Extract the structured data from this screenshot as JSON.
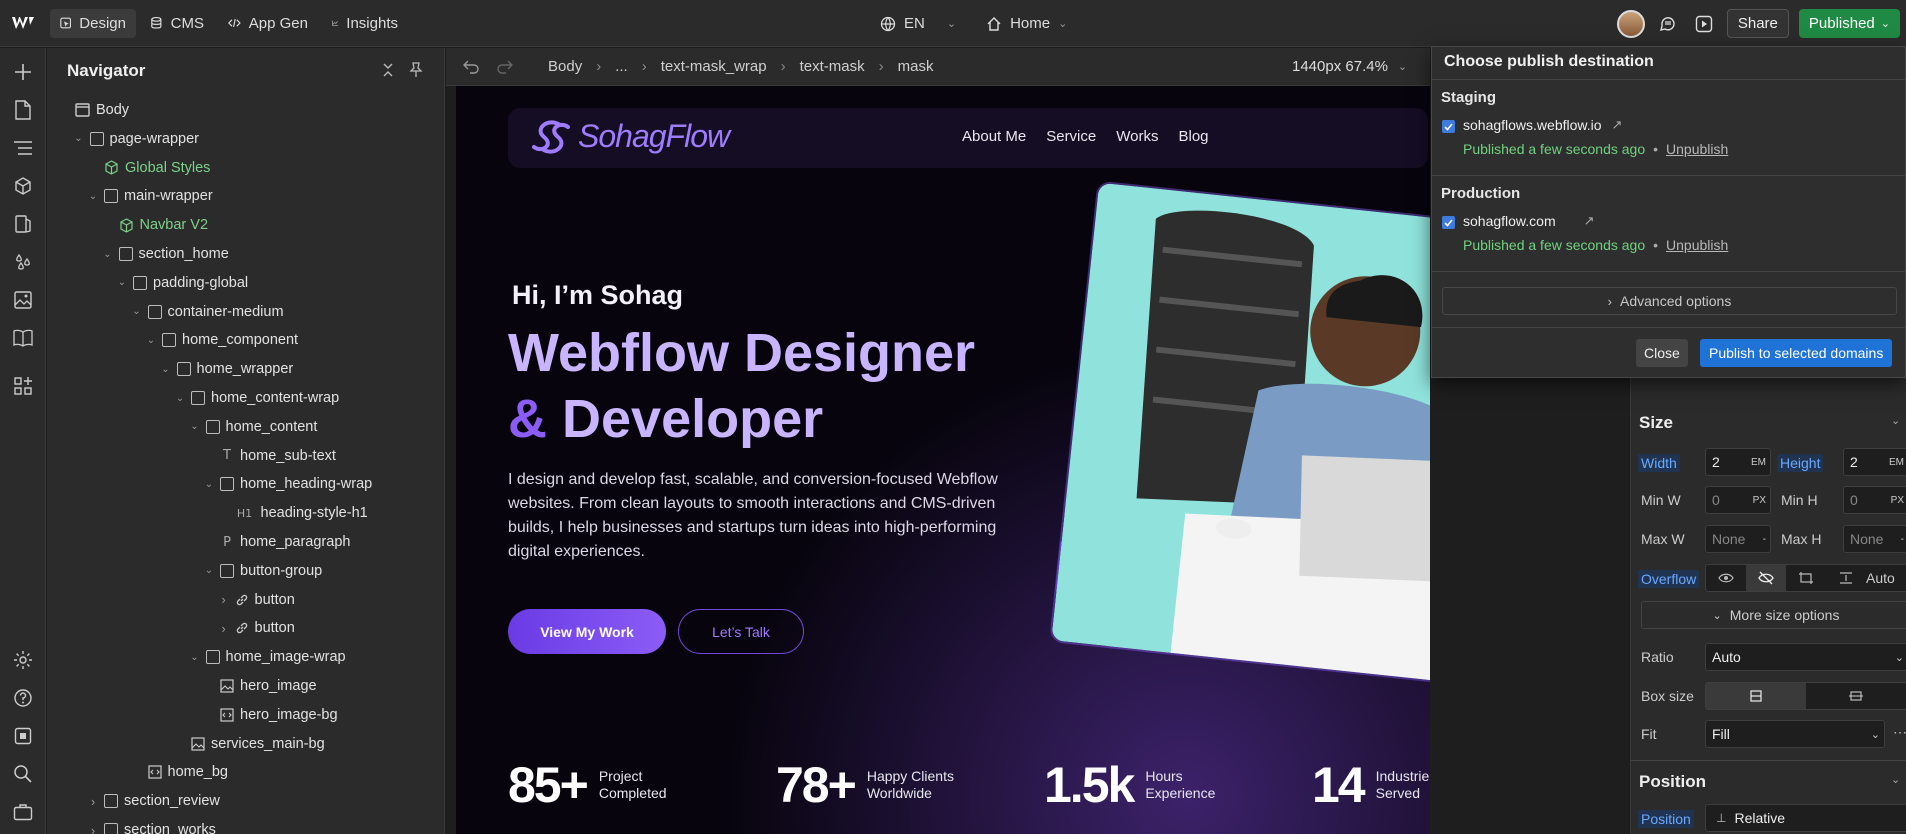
{
  "topbar": {
    "modes": [
      {
        "label": "Design",
        "icon": "cursor-icon"
      },
      {
        "label": "CMS",
        "icon": "database-icon"
      },
      {
        "label": "App Gen",
        "icon": "code-icon"
      },
      {
        "label": "Insights",
        "icon": "chart-icon"
      }
    ],
    "locale": "EN",
    "page": "Home",
    "share_label": "Share",
    "publish_label": "Published"
  },
  "navigator": {
    "title": "Navigator",
    "nodes": [
      {
        "label": "Body",
        "kind": "body"
      },
      {
        "label": "page-wrapper",
        "kind": "box"
      },
      {
        "label": "Global Styles",
        "kind": "component"
      },
      {
        "label": "main-wrapper",
        "kind": "box"
      },
      {
        "label": "Navbar V2",
        "kind": "component"
      },
      {
        "label": "section_home",
        "kind": "box"
      },
      {
        "label": "padding-global",
        "kind": "box"
      },
      {
        "label": "container-medium",
        "kind": "box"
      },
      {
        "label": "home_component",
        "kind": "box"
      },
      {
        "label": "home_wrapper",
        "kind": "box"
      },
      {
        "label": "home_content-wrap",
        "kind": "box"
      },
      {
        "label": "home_content",
        "kind": "box"
      },
      {
        "label": "home_sub-text",
        "kind": "text",
        "tag": "T"
      },
      {
        "label": "home_heading-wrap",
        "kind": "box"
      },
      {
        "label": "heading-style-h1",
        "kind": "heading",
        "tag": "H1"
      },
      {
        "label": "home_paragraph",
        "kind": "paragraph",
        "tag": "P"
      },
      {
        "label": "button-group",
        "kind": "box"
      },
      {
        "label": "button",
        "kind": "link"
      },
      {
        "label": "button",
        "kind": "link"
      },
      {
        "label": "home_image-wrap",
        "kind": "box"
      },
      {
        "label": "hero_image",
        "kind": "image"
      },
      {
        "label": "hero_image-bg",
        "kind": "embed"
      },
      {
        "label": "services_main-bg",
        "kind": "image"
      },
      {
        "label": "home_bg",
        "kind": "embed"
      },
      {
        "label": "section_review",
        "kind": "box"
      },
      {
        "label": "section_works",
        "kind": "box"
      }
    ]
  },
  "canvas_bar": {
    "breadcrumb": [
      "Body",
      "...",
      "text-mask_wrap",
      "text-mask",
      "mask"
    ],
    "zoom": "1440px 67.4%"
  },
  "site": {
    "brand": "SohagFlow",
    "links": [
      "About Me",
      "Service",
      "Works",
      "Blog"
    ],
    "hi": "Hi, I’m Sohag",
    "heading_line1": "Webflow Designer",
    "heading_amp": "&",
    "heading_line2": " Developer",
    "paragraph": "I design and develop fast, scalable, and conversion-focused Webflow websites. From clean layouts to smooth interactions and CMS-driven builds, I help businesses and startups turn ideas into high-performing digital experiences.",
    "btn_primary": "View My Work",
    "btn_secondary": "Let’s Talk",
    "stats": [
      {
        "num": "85+",
        "l1": "Project",
        "l2": "Completed"
      },
      {
        "num": "78+",
        "l1": "Happy Clients",
        "l2": "Worldwide"
      },
      {
        "num": "1.5k",
        "l1": "Hours",
        "l2": "Experience"
      },
      {
        "num": "14",
        "l1": "Industries",
        "l2": "Served"
      }
    ]
  },
  "publish_popup": {
    "title": "Choose publish destination",
    "staging_label": "Staging",
    "staging_domain": "sohagflows.webflow.io",
    "staging_status": "Published a few seconds ago",
    "production_label": "Production",
    "production_domain": "sohagflow.com",
    "production_status": "Published a few seconds ago",
    "bullet": "•",
    "unpublish": "Unpublish",
    "advanced": "Advanced options",
    "close": "Close",
    "publish": "Publish to selected domains"
  },
  "style_panel": {
    "size_title": "Size",
    "width_label": "Width",
    "width_value": "2",
    "width_unit": "EM",
    "height_label": "Height",
    "height_value": "2",
    "height_unit": "EM",
    "minw_label": "Min W",
    "minw_value": "0",
    "minw_unit": "PX",
    "minh_label": "Min H",
    "minh_value": "0",
    "minh_unit": "PX",
    "maxw_label": "Max W",
    "maxw_value": "None",
    "maxh_label": "Max H",
    "maxh_value": "None",
    "overflow_label": "Overflow",
    "overflow_auto": "Auto",
    "more_size": "More size options",
    "ratio_label": "Ratio",
    "ratio_value": "Auto",
    "boxsize_label": "Box size",
    "fit_label": "Fit",
    "fit_value": "Fill",
    "position_title": "Position",
    "position_label": "Position",
    "position_value": "Relative"
  },
  "colors": {
    "accent": "#8b5cf6",
    "publish_green": "#1f8a43",
    "primary_blue": "#1f73d6",
    "status_green": "#6fd37e"
  }
}
